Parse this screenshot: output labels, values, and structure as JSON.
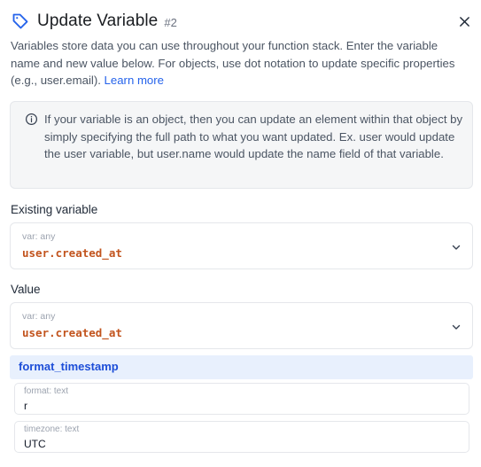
{
  "header": {
    "title": "Update Variable",
    "badge": "#2"
  },
  "description": {
    "text": "Variables store data you can use throughout your function stack. Enter the variable name and new value below. For objects, use dot notation to update specific properties (e.g., user.email).",
    "link": "Learn more"
  },
  "info": {
    "text": "If your variable is an object, then you can update an element within that object by simply specifying the full path to what you want updated. Ex. user would update the user variable, but user.name would update the name field of that variable."
  },
  "existing_variable": {
    "label": "Existing variable",
    "hint": "var: any",
    "value": "user.created_at"
  },
  "value_field": {
    "label": "Value",
    "hint": "var: any",
    "value": "user.created_at"
  },
  "filter": {
    "name": "format_timestamp",
    "params": [
      {
        "hint": "format: text",
        "value": "r"
      },
      {
        "hint": "timezone: text",
        "value": "UTC"
      }
    ]
  },
  "colors": {
    "accent": "#2563eb",
    "variable": "#c2541e",
    "filter_bg": "#e8f0fd"
  },
  "icons": [
    "tag-icon",
    "close-icon",
    "info-icon",
    "chevron-down-icon"
  ]
}
